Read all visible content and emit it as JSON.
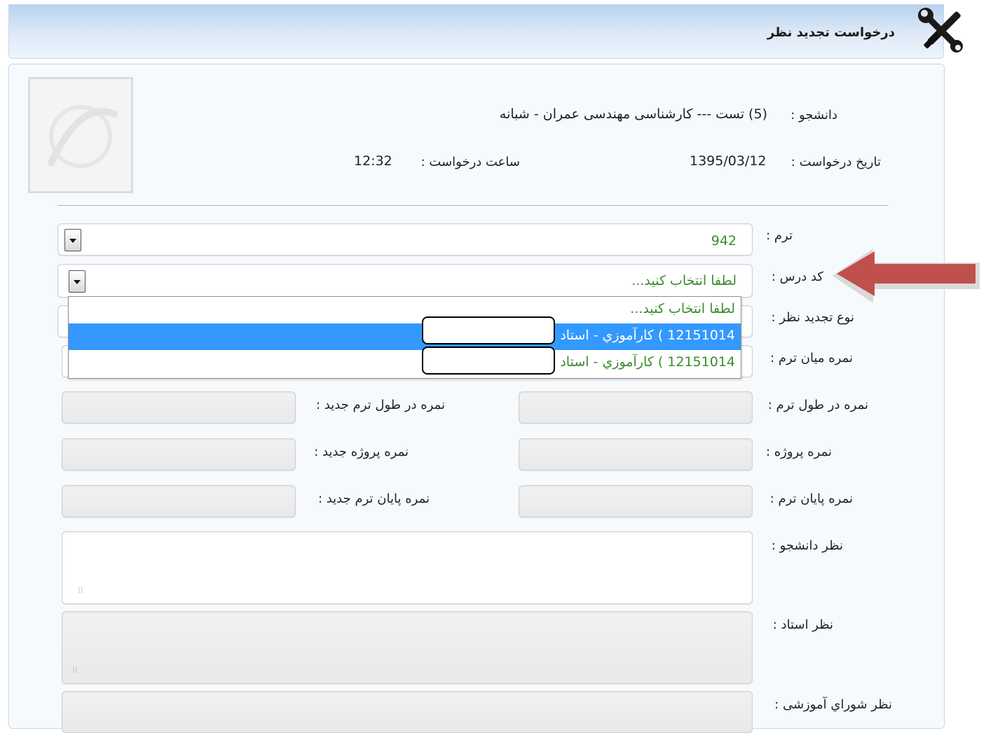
{
  "header": {
    "title": "درخواست تجدید نظر",
    "icon": "tools-icon"
  },
  "student": {
    "label": "دانشجو :",
    "value": "(5) تست --- کارشناسی مهندسی عمران - شبانه"
  },
  "request": {
    "date_label": "تاریخ درخواست :",
    "date_value": "1395/03/12",
    "time_label": "ساعت درخواست :",
    "time_value": "12:32"
  },
  "photo": {
    "icon": "student-photo-placeholder"
  },
  "form": {
    "term": {
      "label": "ترم :",
      "value": "942"
    },
    "course_code": {
      "label": "کد درس :",
      "value": "لطفا انتخاب کنید...",
      "options": [
        "لطفا انتخاب کنید...",
        "12151014 ) کارآموزي - استاد",
        "12151014 ) کارآموزي - استاد"
      ],
      "highlighted_index": 1
    },
    "review_type": {
      "label": "نوع تجدید نظر :"
    },
    "midterm_grade": {
      "label": "نمره میان ترم :"
    },
    "during_term_grade": {
      "label": "نمره در طول ترم :"
    },
    "new_during_term_grade": {
      "label": "نمره در طول ترم جدید :"
    },
    "project_grade": {
      "label": "نمره پروژه :"
    },
    "new_project_grade": {
      "label": "نمره پروژه جدید :"
    },
    "final_grade": {
      "label": "نمره پایان ترم :"
    },
    "new_final_grade": {
      "label": "نمره پایان ترم جدید :"
    },
    "student_opinion": {
      "label": "نظر دانشجو :"
    },
    "teacher_opinion": {
      "label": "نظر استاد :"
    },
    "council_opinion": {
      "label": "نظر شوراي آموزشی :"
    }
  },
  "colors": {
    "header_gradient_top": "#b9d3ef",
    "selection_highlight": "#3399ff",
    "option_text": "#3a8d2c",
    "arrow_fill": "#c0504d"
  }
}
